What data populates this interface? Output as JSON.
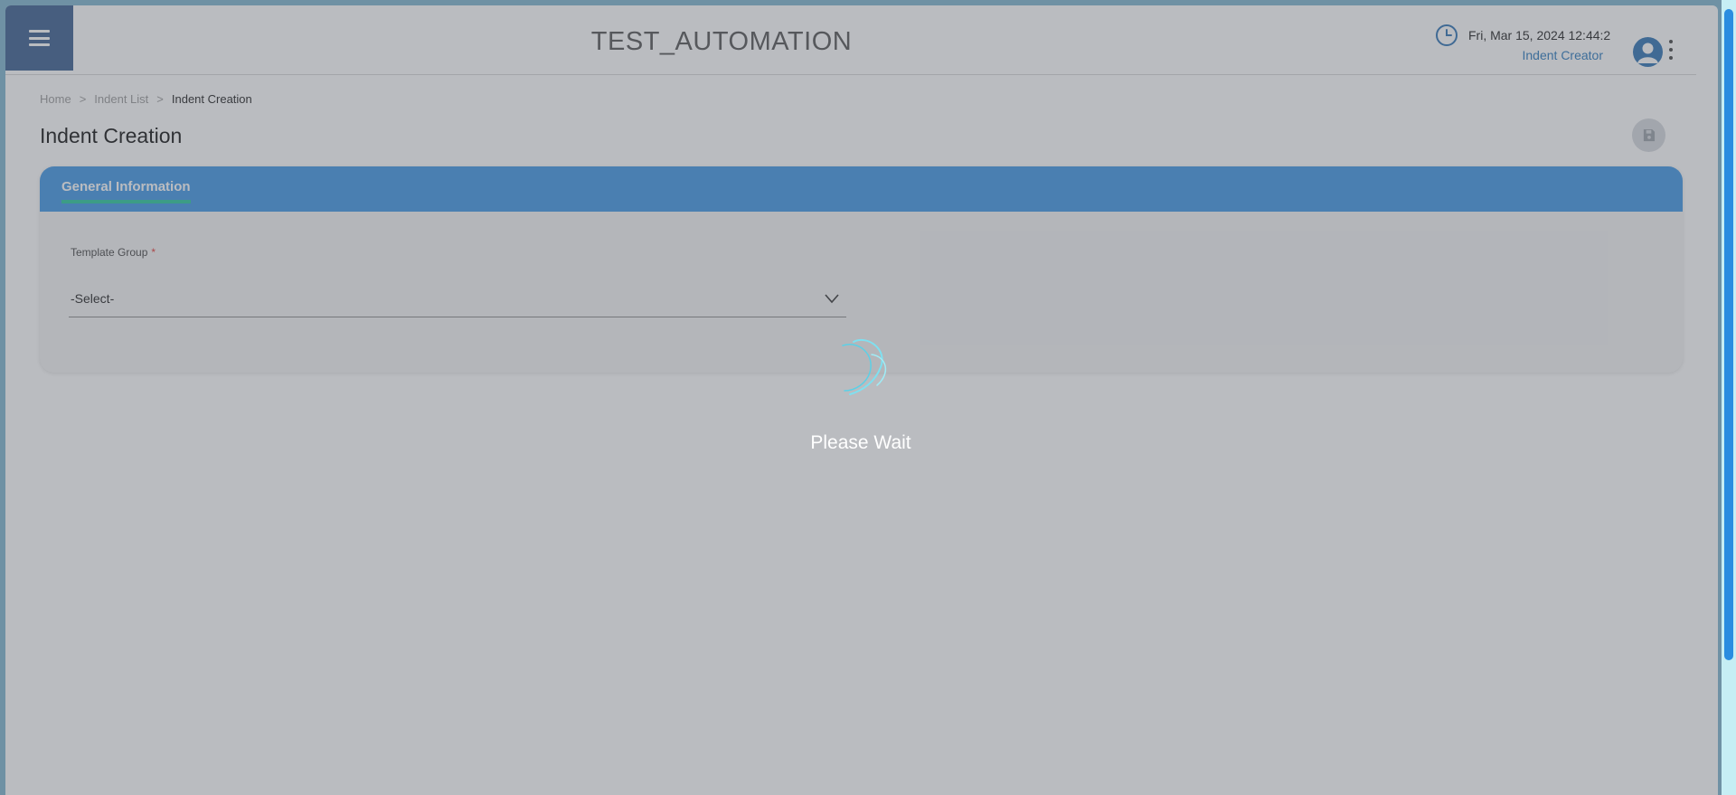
{
  "header": {
    "app_title": "TEST_AUTOMATION",
    "datetime": "Fri, Mar 15, 2024 12:44:2",
    "role": "Indent Creator"
  },
  "breadcrumb": {
    "items": [
      "Home",
      "Indent List",
      "Indent Creation"
    ],
    "separator": ">"
  },
  "page": {
    "title": "Indent Creation"
  },
  "card": {
    "tab_label": "General Information",
    "fields": [
      {
        "label": "Template Group",
        "required_mark": "*",
        "value": "-Select-"
      }
    ]
  },
  "overlay": {
    "message": "Please Wait"
  },
  "colors": {
    "menu_bg": "#3a5d8f",
    "accent": "#3e96e6",
    "tab_underline": "#26c99c",
    "required": "#e53935",
    "role_text": "#2a79bd"
  },
  "icons": [
    "hamburger-icon",
    "clock-icon",
    "user-avatar-icon",
    "kebab-menu-icon",
    "save-icon",
    "chevron-down-icon",
    "loading-spinner-icon"
  ]
}
